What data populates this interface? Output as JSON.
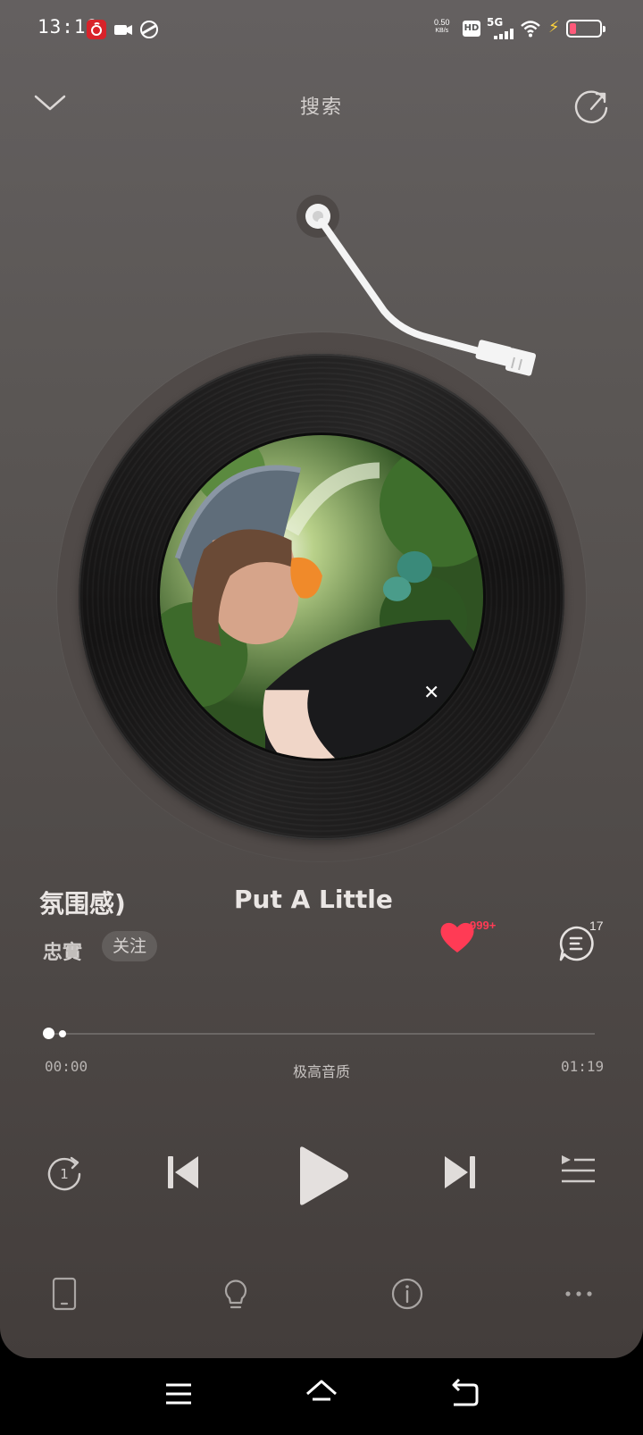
{
  "status_bar": {
    "time": "13:18",
    "net_speed_value": "0.50",
    "net_speed_unit": "KB/s",
    "hd": "HD",
    "network": "5G",
    "netease_icon": "netease-music-icon",
    "battery_level": 0.22,
    "battery_color": "#ff5a7a"
  },
  "header": {
    "title": "搜索"
  },
  "song": {
    "title_left": "氛围感)",
    "title_right": "Put A Little",
    "artist": "忠實",
    "follow_label": "关注",
    "like_count": "999+",
    "comment_count": "17",
    "like_color": "#ff3b55"
  },
  "progress": {
    "current": "00:00",
    "total": "01:19",
    "quality": "极高音质",
    "fraction": 0.0
  },
  "controls": {
    "mode_badge": "1"
  }
}
